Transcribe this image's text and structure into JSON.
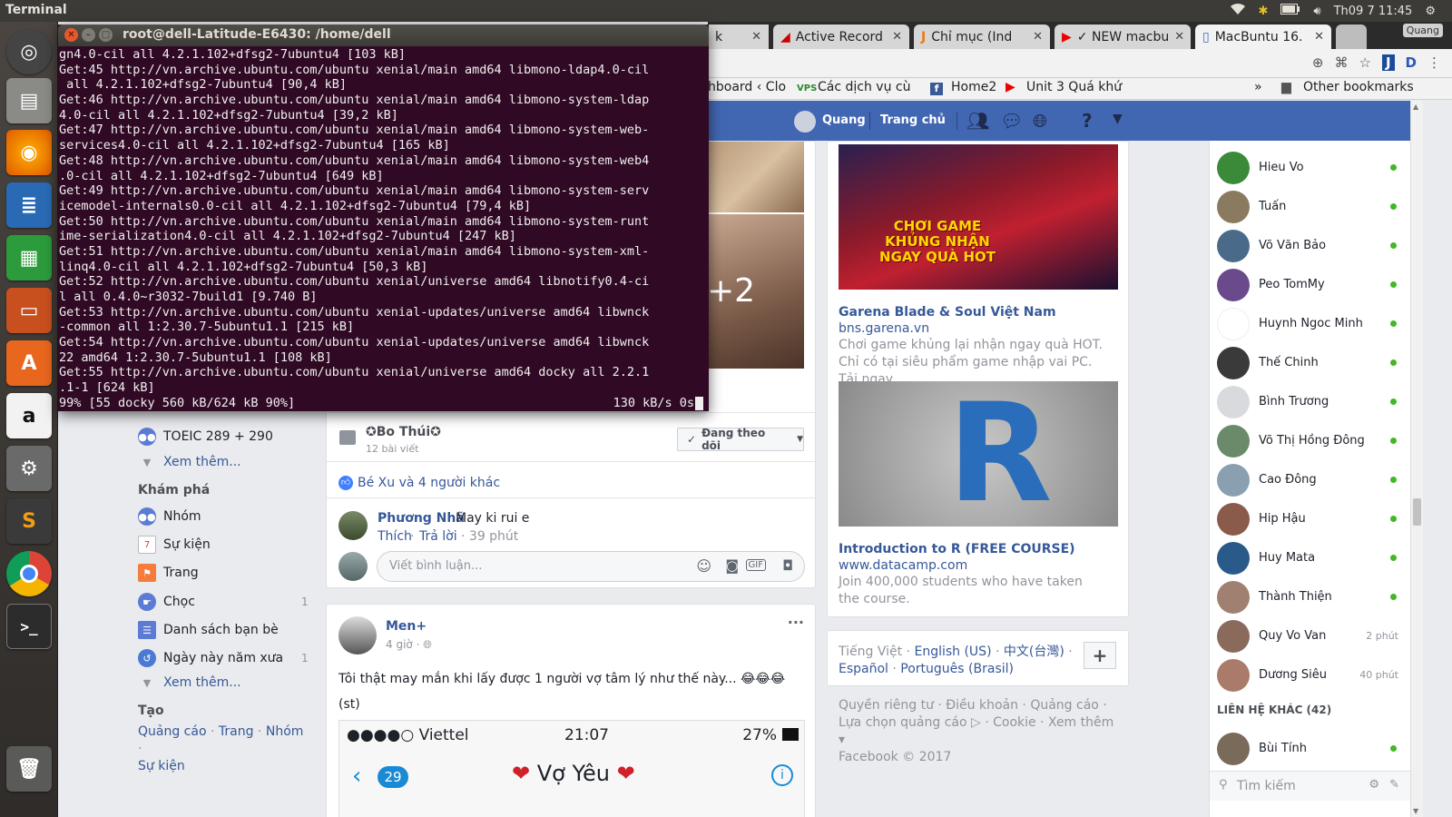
{
  "top_panel": {
    "title": "Terminal",
    "clock": "Th09  7 11:45"
  },
  "launcher": [
    "ubuntu-logo-icon",
    "files-icon",
    "firefox-icon",
    "writer-icon",
    "calc-icon",
    "impress-icon",
    "software-center-icon",
    "amazon-icon",
    "settings-icon",
    "sublime-icon",
    "chrome-icon",
    "terminal-icon",
    "trash-icon"
  ],
  "terminal": {
    "title": "root@dell-Latitude-E6430: /home/dell",
    "lines": [
      "gn4.0-cil all 4.2.1.102+dfsg2-7ubuntu4 [103 kB]",
      "Get:45 http://vn.archive.ubuntu.com/ubuntu xenial/main amd64 libmono-ldap4.0-cil",
      " all 4.2.1.102+dfsg2-7ubuntu4 [90,4 kB]",
      "Get:46 http://vn.archive.ubuntu.com/ubuntu xenial/main amd64 libmono-system-ldap",
      "4.0-cil all 4.2.1.102+dfsg2-7ubuntu4 [39,2 kB]",
      "Get:47 http://vn.archive.ubuntu.com/ubuntu xenial/main amd64 libmono-system-web-",
      "services4.0-cil all 4.2.1.102+dfsg2-7ubuntu4 [165 kB]",
      "Get:48 http://vn.archive.ubuntu.com/ubuntu xenial/main amd64 libmono-system-web4",
      ".0-cil all 4.2.1.102+dfsg2-7ubuntu4 [649 kB]",
      "Get:49 http://vn.archive.ubuntu.com/ubuntu xenial/main amd64 libmono-system-serv",
      "icemodel-internals0.0-cil all 4.2.1.102+dfsg2-7ubuntu4 [79,4 kB]",
      "Get:50 http://vn.archive.ubuntu.com/ubuntu xenial/main amd64 libmono-system-runt",
      "ime-serialization4.0-cil all 4.2.1.102+dfsg2-7ubuntu4 [247 kB]",
      "Get:51 http://vn.archive.ubuntu.com/ubuntu xenial/main amd64 libmono-system-xml-",
      "linq4.0-cil all 4.2.1.102+dfsg2-7ubuntu4 [50,3 kB]",
      "Get:52 http://vn.archive.ubuntu.com/ubuntu xenial/universe amd64 libnotify0.4-ci",
      "l all 0.4.0~r3032-7build1 [9.740 B]",
      "Get:53 http://vn.archive.ubuntu.com/ubuntu xenial-updates/universe amd64 libwnck",
      "-common all 1:2.30.7-5ubuntu1.1 [215 kB]",
      "Get:54 http://vn.archive.ubuntu.com/ubuntu xenial-updates/universe amd64 libwnck",
      "22 amd64 1:2.30.7-5ubuntu1.1 [108 kB]",
      "Get:55 http://vn.archive.ubuntu.com/ubuntu xenial/universe amd64 docky all 2.2.1",
      ".1-1 [624 kB]"
    ],
    "progress_left": "99% [55 docky 560 kB/624 kB 90%]",
    "progress_right": "130 kB/s 0s"
  },
  "browser": {
    "tabs": [
      "k",
      "Active Record",
      "Chỉ mục (Ind",
      "✓ NEW macbu",
      "MacBuntu 16."
    ],
    "profile": "Quang",
    "bookmarks": [
      "hboard ‹ Clo",
      "Các dịch vụ cù",
      "Home2",
      "Unit 3 Quá khứ",
      "Other bookmarks"
    ]
  },
  "fb_header": {
    "user": "Quang",
    "home": "Trang chủ"
  },
  "left_nav": {
    "toeic": "TOEIC 289 + 290",
    "see_more_1": "Xem thêm...",
    "explore_title": "Khám phá",
    "items": [
      {
        "label": "Nhóm",
        "count": ""
      },
      {
        "label": "Sự kiện",
        "count": ""
      },
      {
        "label": "Trang",
        "count": ""
      },
      {
        "label": "Chọc",
        "count": "1"
      },
      {
        "label": "Danh sách bạn bè",
        "count": ""
      },
      {
        "label": "Ngày này năm xưa",
        "count": "1"
      }
    ],
    "see_more_2": "Xem thêm...",
    "create_title": "Tạo",
    "create_links": [
      "Quảng cáo",
      "Trang",
      "Nhóm",
      "Sự kiện"
    ]
  },
  "feed": {
    "photo_more": "+2",
    "group_name": "✪Bo Thúi✪",
    "group_sub": "12 bài viết",
    "follow_btn": "Đang theo dõi",
    "likes": "Bé Xu và 4 người khác",
    "comment_author": "Phương Nhã",
    "comment_text": "May ki rui e",
    "comment_like": "Thích",
    "comment_reply": "Trả lời",
    "comment_time": "39 phút",
    "comment_placeholder": "Viết bình luận...",
    "post2_author": "Men+",
    "post2_time": "4 giờ",
    "post2_text": "Tôi thật may mắn khi lấy được 1 người vợ tâm lý như thế này... 😂😂😂",
    "post2_st": "(st)",
    "phone_carrier": "●●●●○ Viettel",
    "phone_time": "21:07",
    "phone_battery": "27%",
    "phone_badge": "29",
    "phone_contact": "Vợ Yêu"
  },
  "ads": [
    {
      "title": "Garena Blade & Soul Việt Nam",
      "url": "bns.garena.vn",
      "desc": "Chơi game khủng lại nhận ngay quà HOT. Chỉ có tại siêu phẩm game nhập vai PC. Tải ngay",
      "img_text": "CHƠI GAME KHỦNG NHẬN NGAY QUÀ HOT"
    },
    {
      "title": "Introduction to R (FREE COURSE)",
      "url": "www.datacamp.com",
      "desc": "Join 400,000 students who have taken the course.",
      "img_text": "R"
    }
  ],
  "languages": {
    "current": "Tiếng Việt",
    "others": [
      "English (US)",
      "中文(台灣)",
      "Español",
      "Português (Brasil)"
    ]
  },
  "footer": {
    "line1": "Quyền riêng tư · Điều khoản · Quảng cáo ·",
    "line2": "Lựa chọn quảng cáo ▷ · Cookie · Xem thêm ▾",
    "line3": "Facebook © 2017"
  },
  "chat": {
    "contacts": [
      {
        "name": "Hieu Vo",
        "status": "online",
        "color": "#3a8a3a"
      },
      {
        "name": "Tuấn",
        "status": "online",
        "color": "#8a7a60"
      },
      {
        "name": "Võ Văn Bảo",
        "status": "online",
        "color": "#4a6a8a"
      },
      {
        "name": "Peo TomMy",
        "status": "online",
        "color": "#6a4a8a"
      },
      {
        "name": "Huynh Ngoc Minh",
        "status": "online",
        "color": "#ffffff"
      },
      {
        "name": "Thế Chinh",
        "status": "online",
        "color": "#3a3a3a"
      },
      {
        "name": "Bình Trương",
        "status": "online",
        "color": "#d8dade"
      },
      {
        "name": "Võ Thị Hồng Đông",
        "status": "online",
        "color": "#6a8a6a"
      },
      {
        "name": "Cao Đông",
        "status": "online",
        "color": "#8aa0b0"
      },
      {
        "name": "Hip Hậu",
        "status": "online",
        "color": "#8a5a4a"
      },
      {
        "name": "Huy Mata",
        "status": "online",
        "color": "#2a5a8a"
      },
      {
        "name": "Thành Thiện",
        "status": "online",
        "color": "#a08070"
      },
      {
        "name": "Quy Vo Van",
        "status": "2 phút",
        "color": "#8a6a5a"
      },
      {
        "name": "Dương Siêu",
        "status": "40 phút",
        "color": "#aa7a6a"
      }
    ],
    "other_contacts": "LIÊN HỆ KHÁC (42)",
    "extra_contact": "Bùi Tính",
    "search_placeholder": "Tìm kiếm"
  }
}
